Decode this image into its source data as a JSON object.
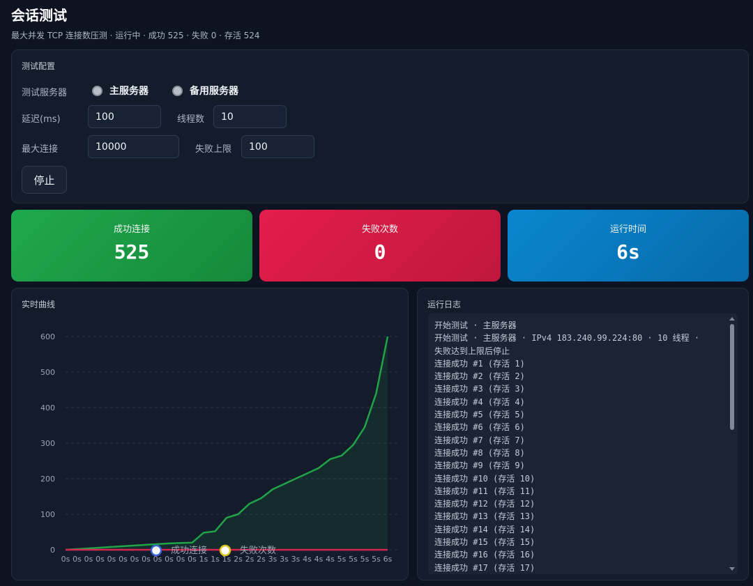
{
  "header": {
    "title": "会话测试",
    "subtitle": "最大并发 TCP 连接数压测 · 运行中 · 成功 525 · 失败 0 · 存活 524"
  },
  "config": {
    "section_title": "测试配置",
    "server_label": "测试服务器",
    "servers": [
      "主服务器",
      "备用服务器"
    ],
    "delay_label": "延迟(ms)",
    "delay_value": "100",
    "threads_label": "线程数",
    "threads_value": "10",
    "max_conn_label": "最大连接",
    "max_conn_value": "10000",
    "fail_limit_label": "失败上限",
    "fail_limit_value": "100",
    "stop_button": "停止"
  },
  "stats": {
    "success_label": "成功连接",
    "success_value": "525",
    "fail_label": "失败次数",
    "fail_value": "0",
    "time_label": "运行时间",
    "time_value": "6s"
  },
  "chart": {
    "section_title": "实时曲线"
  },
  "chart_data": {
    "type": "line",
    "title": "",
    "xlabel": "",
    "ylabel": "",
    "ylim": [
      0,
      600
    ],
    "yticks": [
      0,
      100,
      200,
      300,
      400,
      500,
      600
    ],
    "grid": true,
    "legend_position": "bottom-center",
    "x": [
      "0s",
      "0s",
      "0s",
      "0s",
      "0s",
      "0s",
      "0s",
      "0s",
      "0s",
      "0s",
      "0s",
      "0s",
      "1s",
      "1s",
      "1s",
      "2s",
      "2s",
      "2s",
      "3s",
      "3s",
      "3s",
      "4s",
      "4s",
      "4s",
      "5s",
      "5s",
      "5s",
      "5s",
      "6s"
    ],
    "series": [
      {
        "name": "成功连接",
        "color": "#22a347",
        "values": [
          0,
          2,
          4,
          6,
          8,
          10,
          12,
          14,
          16,
          18,
          19,
          20,
          48,
          52,
          90,
          100,
          130,
          145,
          170,
          185,
          200,
          215,
          230,
          255,
          265,
          295,
          345,
          440,
          600
        ]
      },
      {
        "name": "失败次数",
        "color": "#d42451",
        "values": [
          0,
          0,
          0,
          0,
          0,
          0,
          0,
          0,
          0,
          0,
          0,
          0,
          0,
          0,
          0,
          0,
          0,
          0,
          0,
          0,
          0,
          0,
          0,
          0,
          0,
          0,
          0,
          0,
          0
        ]
      }
    ]
  },
  "log": {
    "section_title": "运行日志",
    "lines": [
      "开始测试 · 主服务器",
      "开始测试 · 主服务器 · IPv4 183.240.99.224:80 · 10 线程 ·",
      "失败达到上限后停止",
      "连接成功 #1 (存活 1)",
      "连接成功 #2 (存活 2)",
      "连接成功 #3 (存活 3)",
      "连接成功 #4 (存活 4)",
      "连接成功 #5 (存活 5)",
      "连接成功 #6 (存活 6)",
      "连接成功 #7 (存活 7)",
      "连接成功 #8 (存活 8)",
      "连接成功 #9 (存活 9)",
      "连接成功 #10 (存活 10)",
      "连接成功 #11 (存活 11)",
      "连接成功 #12 (存活 12)",
      "连接成功 #13 (存活 13)",
      "连接成功 #14 (存活 14)",
      "连接成功 #15 (存活 15)",
      "连接成功 #16 (存活 16)",
      "连接成功 #17 (存活 17)"
    ]
  }
}
